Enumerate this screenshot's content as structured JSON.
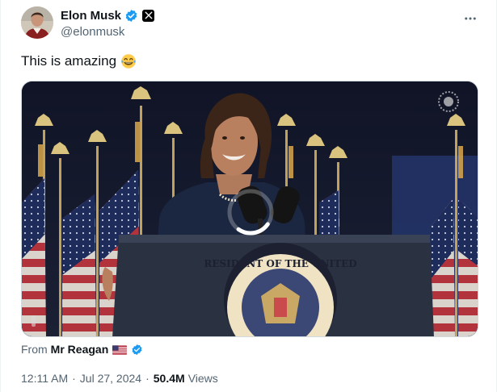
{
  "author": {
    "name": "Elon Musk",
    "handle": "@elonmusk"
  },
  "tweet": {
    "text": "This is amazing"
  },
  "attribution": {
    "prefix": "From",
    "name": "Mr Reagan"
  },
  "meta": {
    "time": "12:11 AM",
    "separator": "·",
    "date": "Jul 27, 2024",
    "views_count": "50.4M",
    "views_label": "Views"
  },
  "media": {
    "seal_text": "RESIDENT OF THE UNITED"
  },
  "colors": {
    "verified_blue": "#1d9bf0",
    "secondary_text": "#536471",
    "primary_text": "#0f1419"
  },
  "icons": {
    "verified": "verified-checkmark-icon",
    "x_logo": "x-logo-icon",
    "more": "more-horizontal-icon",
    "emoji": "face-with-tears-of-joy-icon",
    "flag": "us-flag-icon",
    "loading": "loading-spinner-icon"
  }
}
